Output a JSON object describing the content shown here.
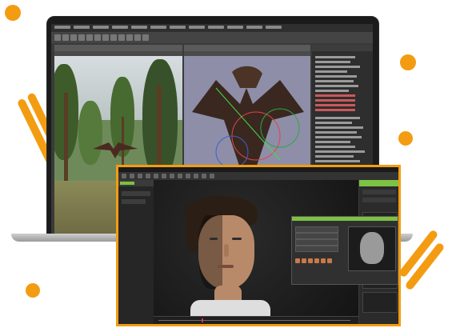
{
  "scene": {
    "accent": "#f39c12",
    "ui_green": "#7dc242"
  },
  "laptop": {
    "viewport_left": "forest-photo-reference",
    "viewport_center": "dragon-rig",
    "outliner": "outliner-panel"
  },
  "app": {
    "viewport": "character-head-3d",
    "dialog": "expression-settings-dialog"
  },
  "icons": [
    "close-icon",
    "play-icon",
    "gear-icon"
  ]
}
